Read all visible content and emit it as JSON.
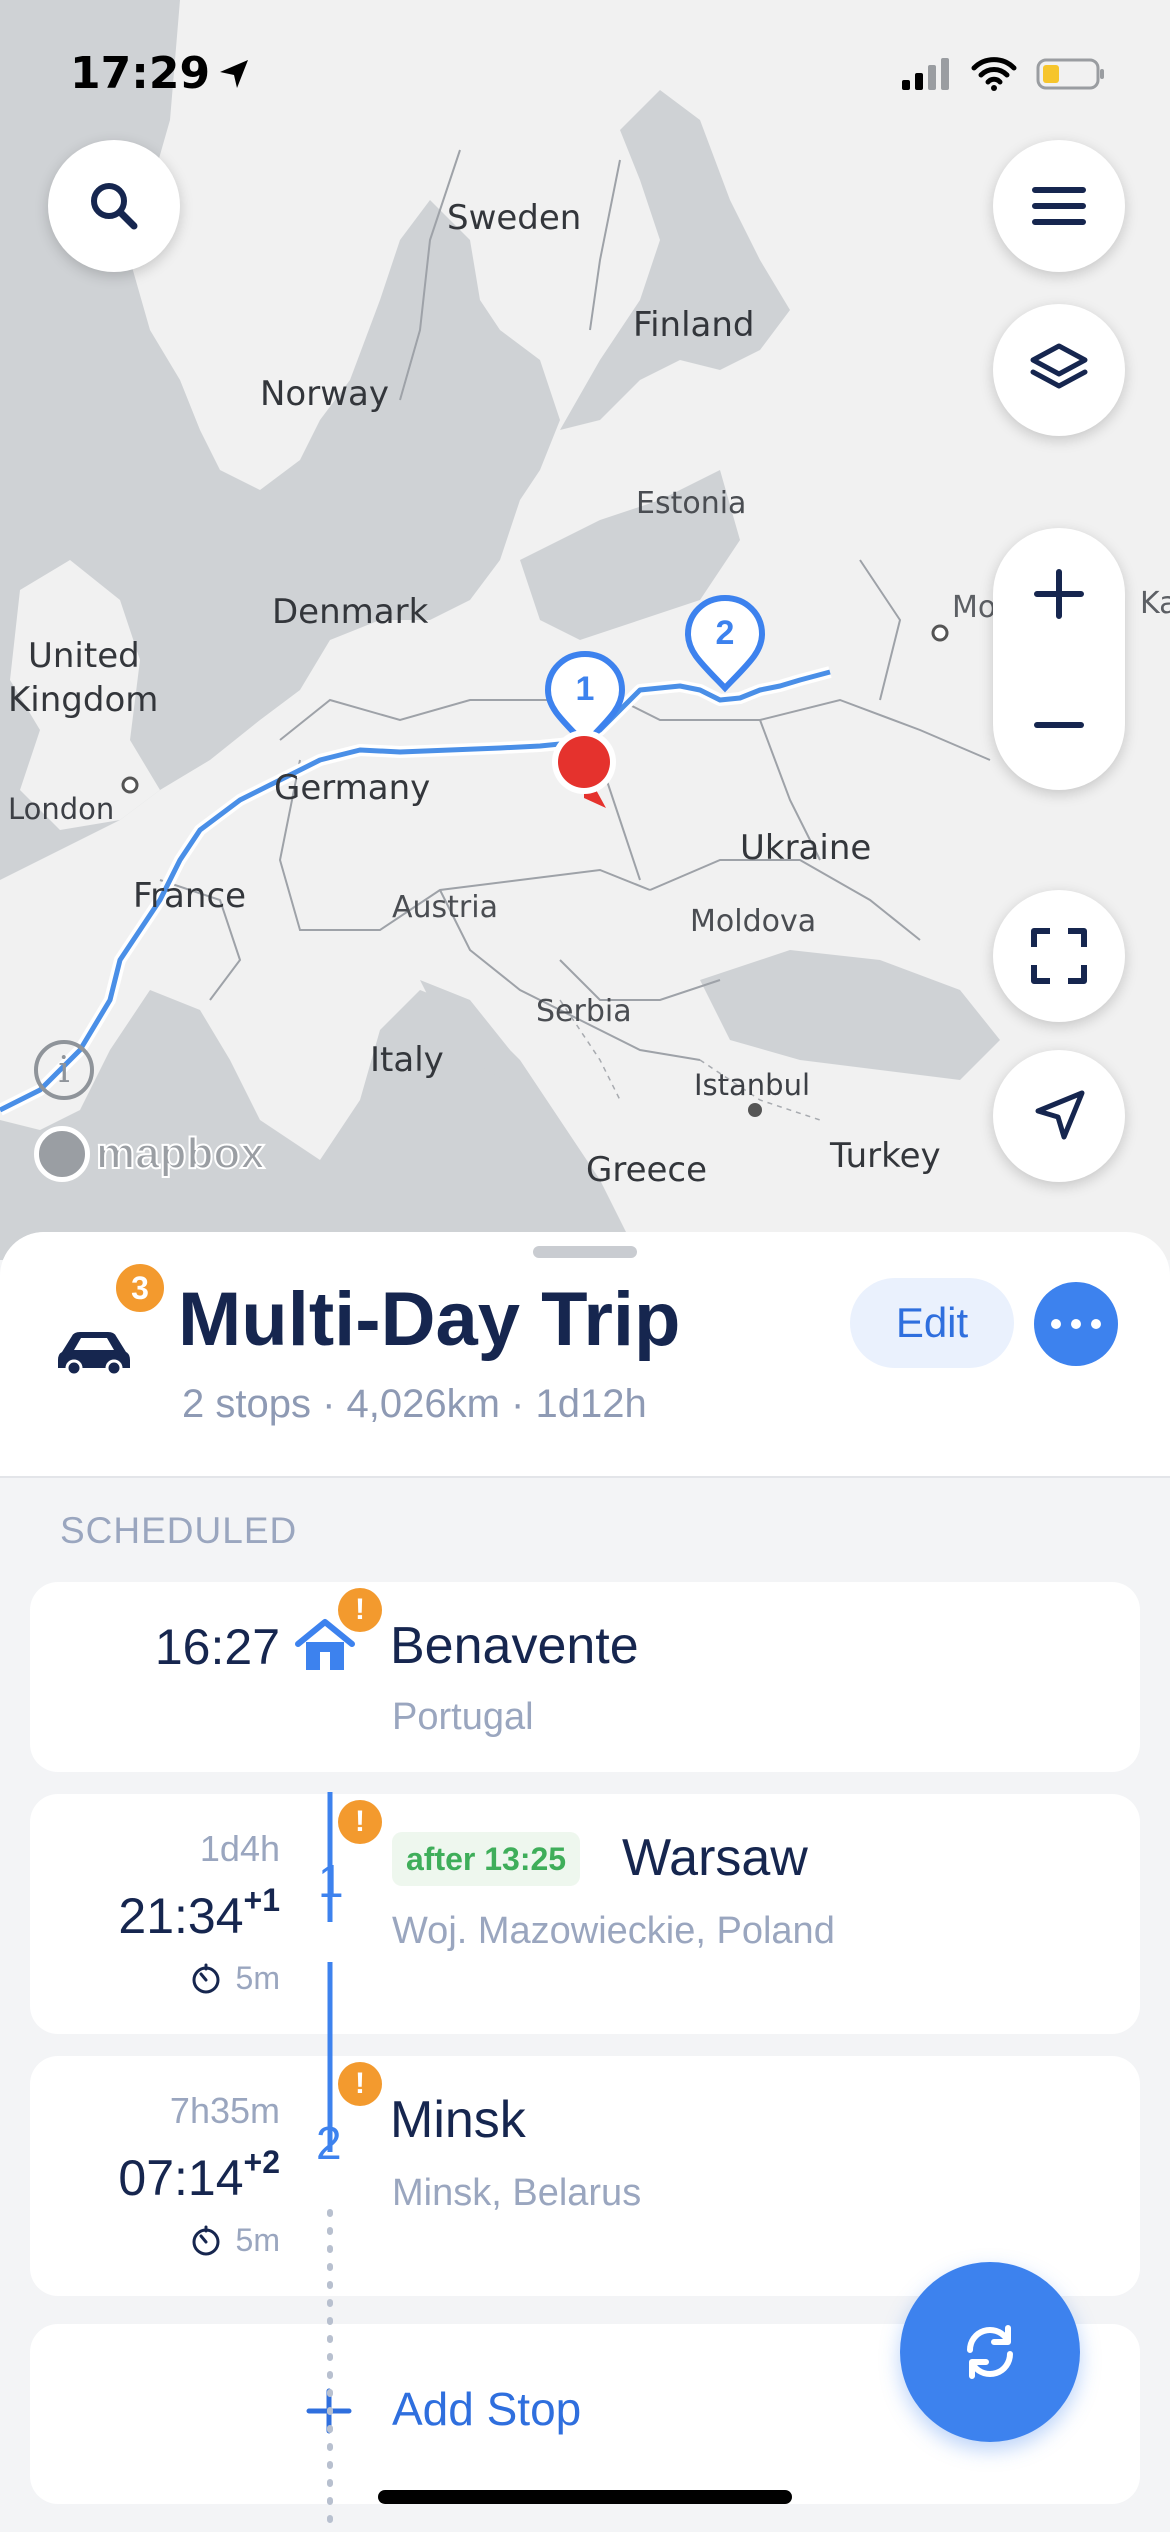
{
  "status_bar": {
    "time": "17:29"
  },
  "map": {
    "countries": [
      "Sweden",
      "Finland",
      "Norway",
      "Estonia",
      "Denmark",
      "United",
      "Kingdom",
      "Germany",
      "France",
      "Austria",
      "Ukraine",
      "Moldova",
      "Italy",
      "Serbia",
      "Greece",
      "Turkey"
    ],
    "cities": [
      "London",
      "Istanbul",
      "Mo",
      "Ka"
    ],
    "attribution": "mapbox",
    "route_markers": [
      "1",
      "2"
    ],
    "route_color": "#4a8fe7",
    "current_location_color": "#e5322d",
    "buttons": {
      "search_icon": "search-icon",
      "menu_icon": "hamburger-menu-icon",
      "layers_icon": "layers-icon",
      "zoom_in_icon": "plus-icon",
      "zoom_out_icon": "minus-icon",
      "fit_icon": "fullscreen-icon",
      "locate_icon": "navigation-arrow-icon"
    }
  },
  "trip": {
    "vehicle_badge": "3",
    "title": "Multi-Day Trip",
    "summary": "2 stops · 4,026km · 1d12h",
    "edit_label": "Edit"
  },
  "schedule": {
    "section_label": "SCHEDULED",
    "stops": [
      {
        "time": "16:27",
        "name": "Benavente",
        "region": "Portugal"
      },
      {
        "marker": "1",
        "duration": "1d4h",
        "time": "21:34",
        "day_offset": "+1",
        "wait": "5m",
        "after": "after 13:25",
        "name": "Warsaw",
        "region": "Woj. Mazowieckie, Poland"
      },
      {
        "marker": "2",
        "duration": "7h35m",
        "time": "07:14",
        "day_offset": "+2",
        "wait": "5m",
        "name": "Minsk",
        "region": "Minsk, Belarus"
      }
    ],
    "add_stop_label": "Add Stop",
    "warning_glyph": "!"
  },
  "colors": {
    "accent": "#3d82ee",
    "warning": "#f39a2e",
    "title": "#16264f",
    "muted": "#9aa6bf",
    "green": "#3fae5a"
  }
}
